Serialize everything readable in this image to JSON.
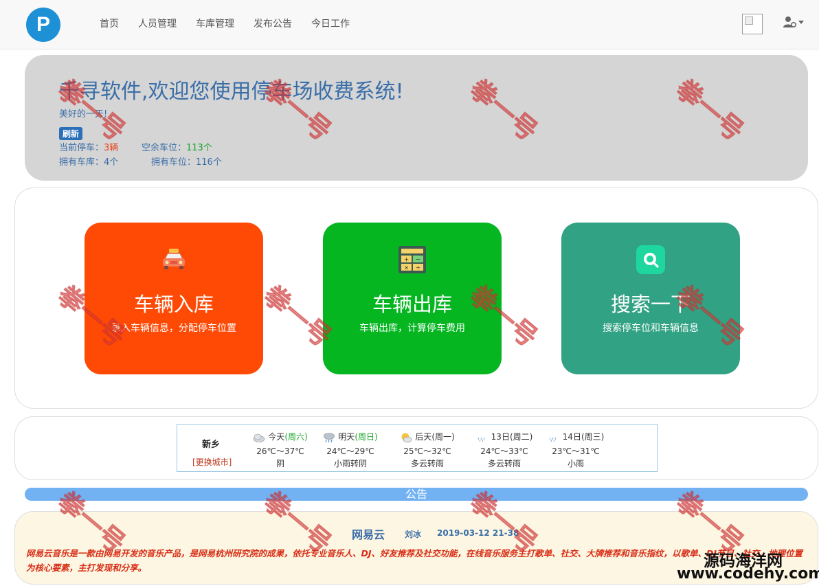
{
  "nav": {
    "logo_letter": "P",
    "links": [
      "首页",
      "人员管理",
      "车库管理",
      "发布公告",
      "今日工作"
    ]
  },
  "jumbotron": {
    "title": "千寻软件,欢迎您使用停车场收费系统!",
    "subtitle": "美好的一天!",
    "refresh_label": "刷新",
    "current_parked_label": "当前停车：",
    "current_parked_value": "3辆",
    "free_spaces_label": "空余车位：",
    "free_spaces_value": "113个",
    "garages_label": "拥有车库：",
    "garages_value": "4个",
    "spaces_label": "拥有车位：",
    "spaces_value": "116个"
  },
  "cards": [
    {
      "title": "车辆入库",
      "desc": "录入车辆信息，分配停车位置",
      "color": "#ff4a06",
      "icon": "taxi-icon"
    },
    {
      "title": "车辆出库",
      "desc": "车辆出库，计算停车费用",
      "color": "#05b621",
      "icon": "calculator-icon"
    },
    {
      "title": "搜索一下",
      "desc": "搜索停车位和车辆信息",
      "color": "#31a283",
      "icon": "search-icon"
    }
  ],
  "weather": {
    "city": "新乡",
    "change_city": "[更换城市]",
    "days": [
      {
        "day": "今天",
        "weekday": "(周六)",
        "temp": "26℃～37℃",
        "desc": "阴",
        "icon": "cloudy-icon"
      },
      {
        "day": "明天",
        "weekday": "(周日)",
        "temp": "24℃～29℃",
        "desc": "小雨转阴",
        "icon": "rain-icon"
      },
      {
        "day": "后天",
        "weekday": "(周一)",
        "temp": "25℃～32℃",
        "desc": "多云转雨",
        "icon": "partly-cloudy-icon"
      },
      {
        "day": "13日",
        "weekday": "(周二)",
        "temp": "24℃～33℃",
        "desc": "多云转雨",
        "icon": "drizzle-icon"
      },
      {
        "day": "14日",
        "weekday": "(周三)",
        "temp": "23℃～31℃",
        "desc": "小雨",
        "icon": "drizzle-icon"
      }
    ]
  },
  "notice": {
    "bar_title": "公告",
    "title": "网易云",
    "author": "刘冰",
    "date": "2019-03-12 21-38",
    "body": "网易云音乐是一款由网易开发的音乐产品，是网易杭州研究院的成果，依托专业音乐人、DJ、好友推荐及社交功能，在线音乐服务主打歌单、社交、大牌推荐和音乐指纹，以歌单、DJ节目、社交、地理位置为核心要素，主打发现和分享。"
  },
  "watermark": {
    "text": "拳一号",
    "site_name": "源码海洋网",
    "site_url": "www.codehy.com"
  }
}
